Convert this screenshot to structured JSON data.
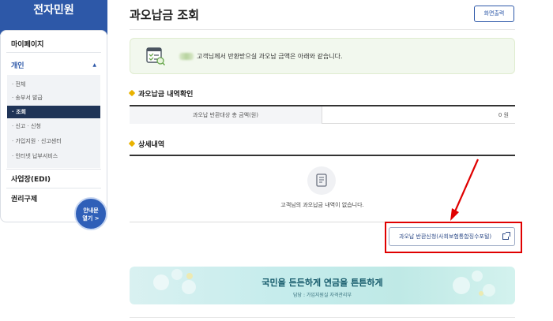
{
  "sidebar": {
    "title": "전자민원",
    "top_items": [
      "마이페이지",
      "개인",
      "사업장(EDI)",
      "권리구제"
    ],
    "sub_items": [
      "· 전체",
      "· 송부서 발급",
      "· 조회",
      "· 신고 · 신청",
      "· 가입지원 · 신고센터",
      "· 인터넷 납부서비스"
    ],
    "guide_button": {
      "line1": "안내문",
      "line2": "열기 >"
    }
  },
  "main": {
    "title": "과오납금 조회",
    "print_button": "화면출력",
    "notice_text": "고객님께서 반환받으실 과오납 금액은 아래와 같습니다.",
    "summary": {
      "heading": "과오납금 내역확인",
      "label": "과오납 반환대상 총 금액(원)",
      "value": "0 원"
    },
    "detail": {
      "heading": "상세내역",
      "empty_text": "고객님의 과오납금 내역이 없습니다."
    },
    "refund_button": "과오납 반환신청(사회보험통합징수포털)",
    "banner": {
      "main": "국민을 든든하게 연금을 튼튼하게",
      "sub": "담당 : 가입지원실 자격관리부"
    }
  },
  "colors": {
    "brand": "#2d58a8",
    "highlight": "#e00000",
    "active": "#1f3457"
  }
}
